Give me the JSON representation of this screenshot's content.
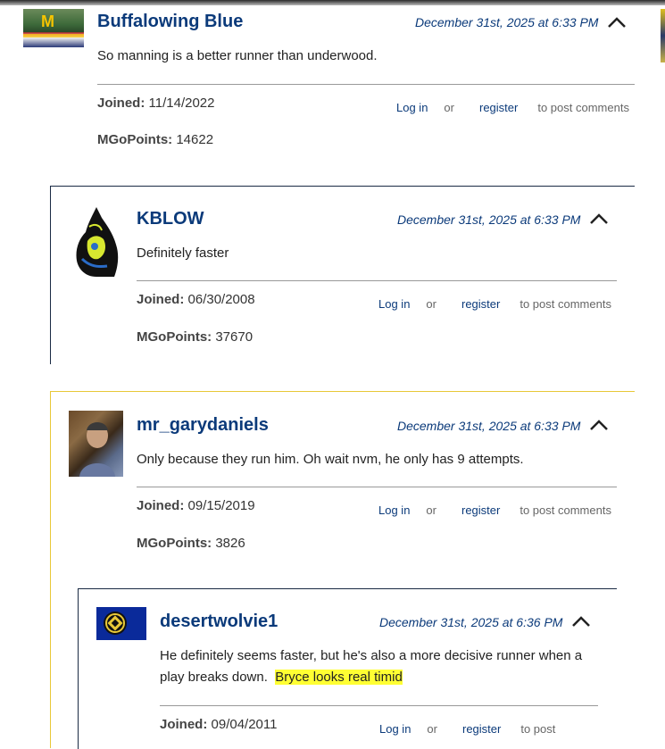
{
  "comments": [
    {
      "author": "Buffalowing Blue",
      "date": "December 31st, 2025 at 6:33 PM",
      "text": "So manning is a better runner than underwood.",
      "joined_label": "Joined:",
      "joined": "11/14/2022",
      "points_label": "MGoPoints:",
      "points": "14622"
    },
    {
      "author": "KBLOW",
      "date": "December 31st, 2025 at 6:33 PM",
      "text": "Definitely faster",
      "joined_label": "Joined:",
      "joined": "06/30/2008",
      "points_label": "MGoPoints:",
      "points": "37670"
    },
    {
      "author": "mr_garydaniels",
      "date": "December 31st, 2025 at 6:33 PM",
      "text": "Only because they run him. Oh wait nvm, he only has 9 attempts.",
      "joined_label": "Joined:",
      "joined": "09/15/2019",
      "points_label": "MGoPoints:",
      "points": "3826"
    },
    {
      "author": "desertwolvie1",
      "date": "December 31st, 2025 at 6:36 PM",
      "text_part1": "He definitely seems faster, but he's also a more decisive runner when a play breaks down.",
      "text_highlight": "Bryce looks real timid",
      "joined_label": "Joined:",
      "joined": "09/04/2011"
    }
  ],
  "links": {
    "login": "Log in",
    "or": "or",
    "register": "register",
    "to_post": "to post comments",
    "to_post_short": "to post"
  },
  "colors": {
    "author": "#0b3a7a",
    "thread_border_dark": "#1a2a44",
    "thread_border_gold": "#e8c838",
    "highlight": "#ffff33"
  },
  "icons": {
    "collapse": "chevron-up-icon"
  }
}
